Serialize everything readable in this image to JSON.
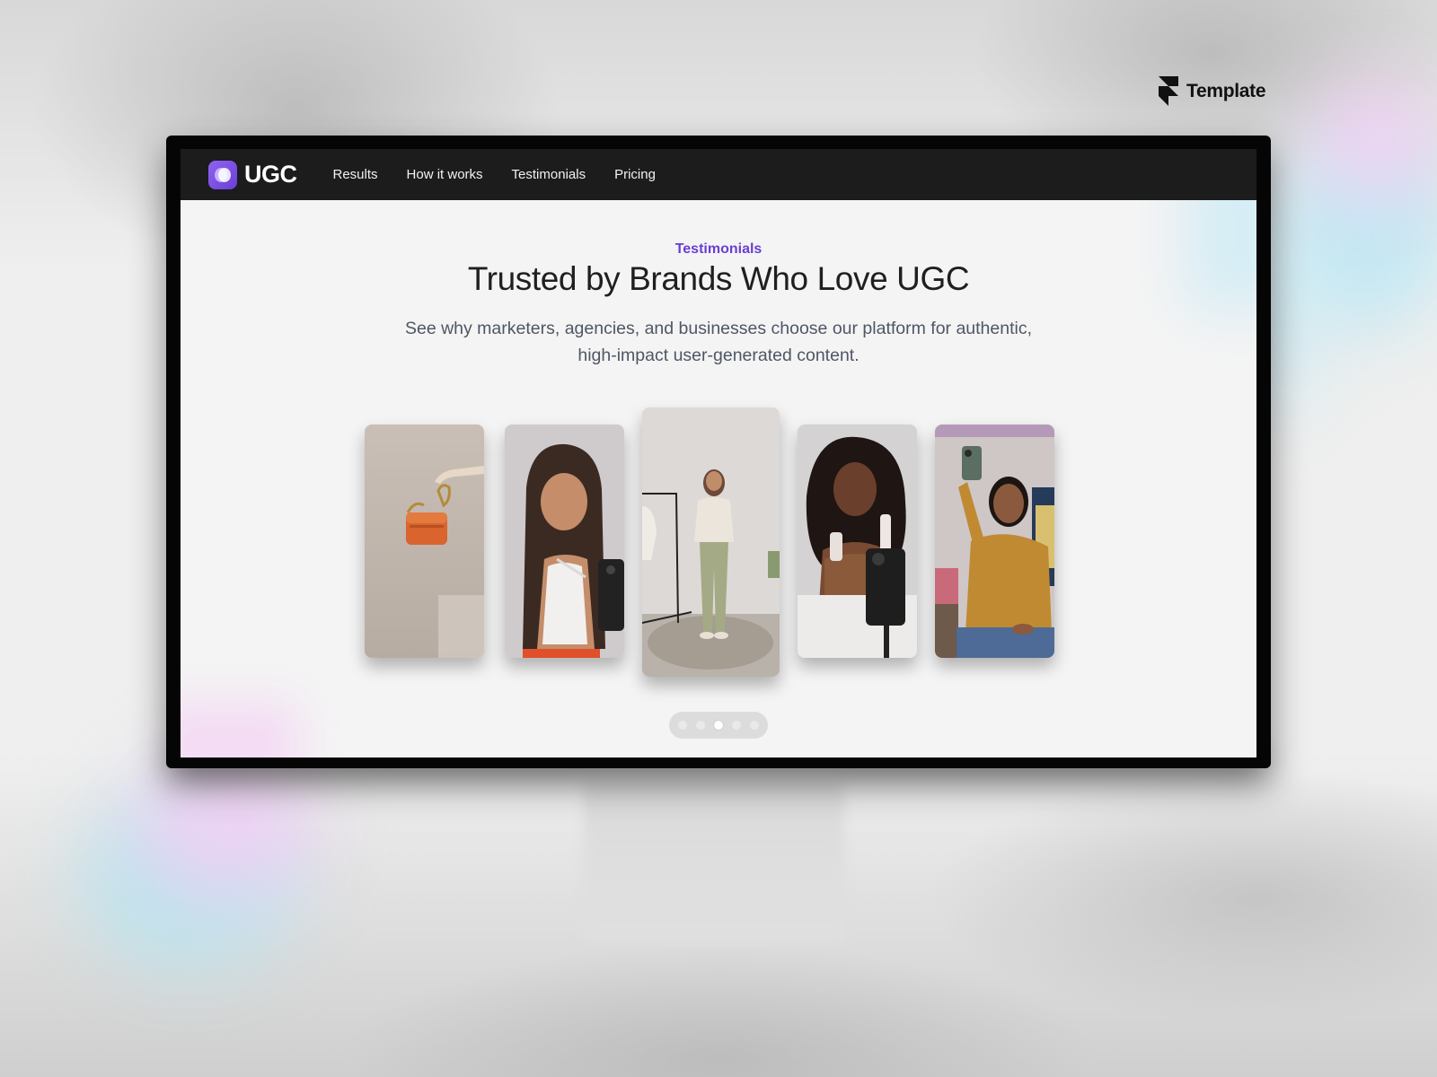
{
  "badge": {
    "text": "Template",
    "icon": "framer-icon"
  },
  "site": {
    "logo_text": "UGC",
    "logo_icon": "ugc-logo-icon",
    "accent_color": "#6a3fd1",
    "nav": [
      {
        "label": "Results"
      },
      {
        "label": "How it works"
      },
      {
        "label": "Testimonials"
      },
      {
        "label": "Pricing"
      }
    ]
  },
  "testimonials": {
    "eyebrow": "Testimonials",
    "title": "Trusted by Brands Who Love UGC",
    "subtitle_line1": "See why marketers, agencies, and businesses choose our platform for authentic,",
    "subtitle_line2": "high-impact user-generated content."
  },
  "carousel": {
    "active_index": 2,
    "count": 5
  }
}
